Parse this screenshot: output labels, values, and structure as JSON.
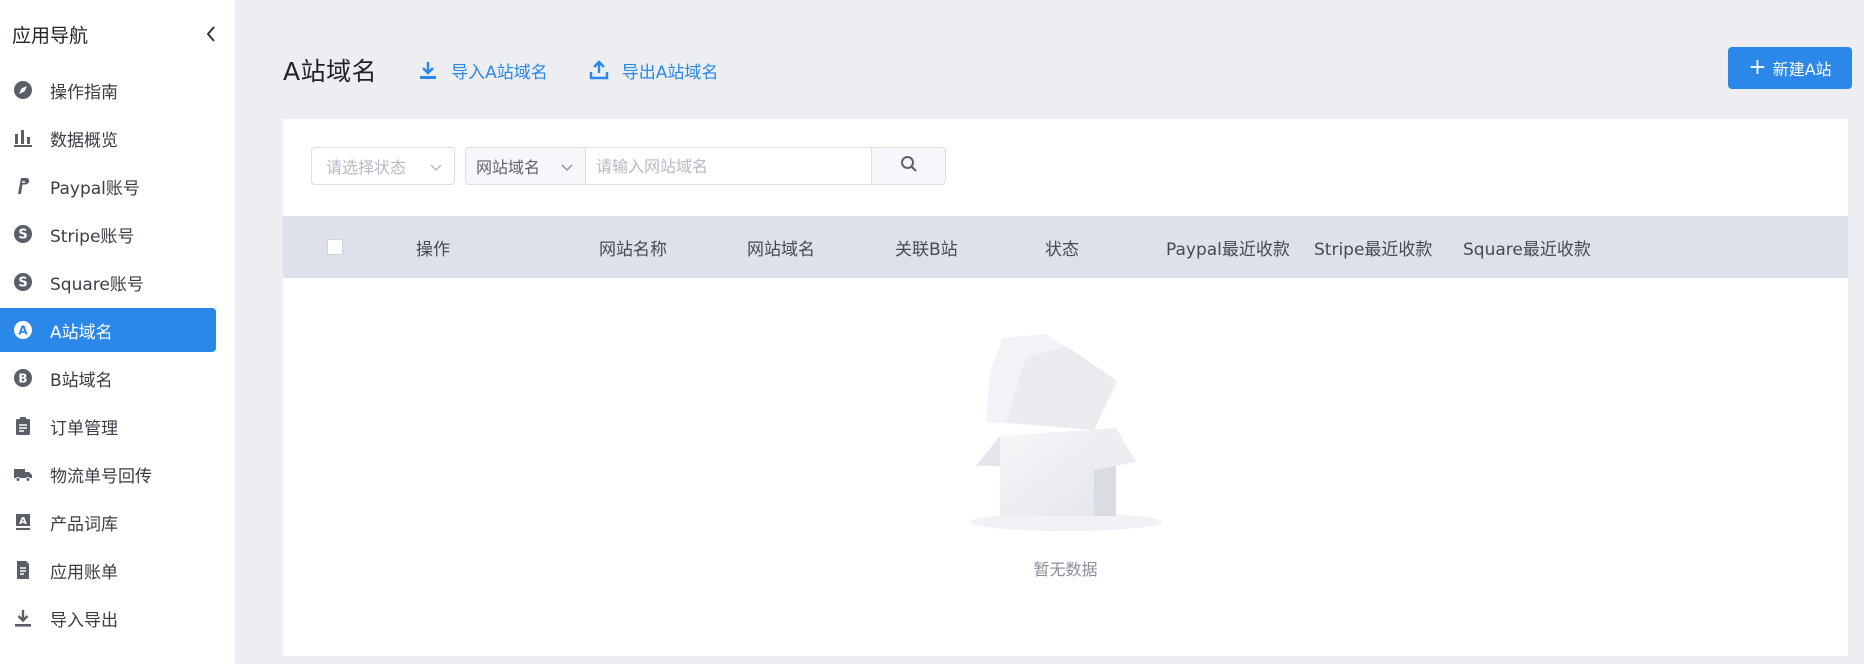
{
  "sidebar": {
    "title": "应用导航",
    "items": [
      {
        "label": "操作指南",
        "icon": "compass-icon",
        "active": false
      },
      {
        "label": "数据概览",
        "icon": "bar-chart-icon",
        "active": false
      },
      {
        "label": "Paypal账号",
        "icon": "paypal-icon",
        "active": false
      },
      {
        "label": "Stripe账号",
        "icon": "dollar-circle-icon",
        "active": false
      },
      {
        "label": "Square账号",
        "icon": "dollar-circle-icon",
        "active": false
      },
      {
        "label": "A站域名",
        "icon": "letter-a-circle-icon",
        "active": true
      },
      {
        "label": "B站域名",
        "icon": "letter-b-circle-icon",
        "active": false
      },
      {
        "label": "订单管理",
        "icon": "clipboard-icon",
        "active": false
      },
      {
        "label": "物流单号回传",
        "icon": "truck-icon",
        "active": false
      },
      {
        "label": "产品词库",
        "icon": "text-box-icon",
        "active": false
      },
      {
        "label": "应用账单",
        "icon": "document-icon",
        "active": false
      },
      {
        "label": "导入导出",
        "icon": "download-icon",
        "active": false
      }
    ]
  },
  "header": {
    "title": "A站域名",
    "import_label": "导入A站域名",
    "export_label": "导出A站域名",
    "new_label": "新建A站"
  },
  "filters": {
    "status_placeholder": "请选择状态",
    "field_select": "网站域名",
    "search_placeholder": "请输入网站域名"
  },
  "table": {
    "columns": [
      "操作",
      "网站名称",
      "网站域名",
      "关联B站",
      "状态",
      "Paypal最近收款",
      "Stripe最近收款",
      "Square最近收款"
    ],
    "empty_text": "暂无数据"
  },
  "colors": {
    "accent": "#2b87e8",
    "background": "#eceef2",
    "table_header": "#dde1e9"
  }
}
